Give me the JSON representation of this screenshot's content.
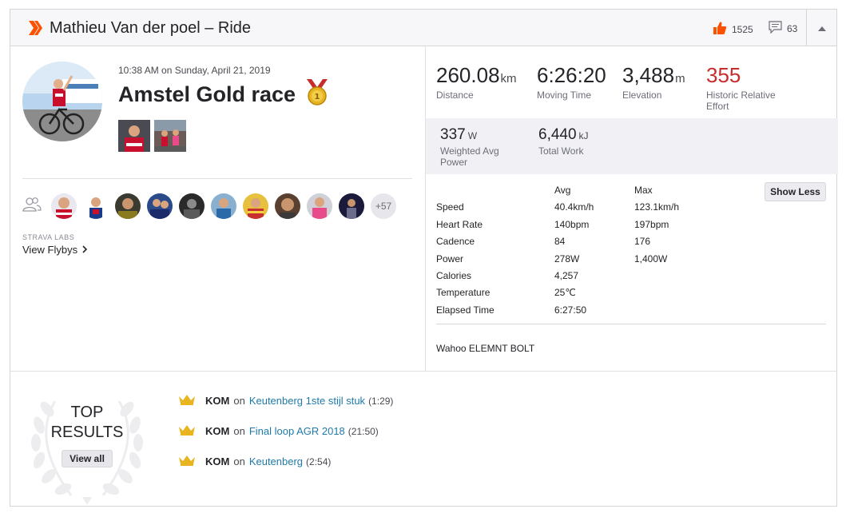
{
  "header": {
    "title": "Mathieu Van der poel – Ride",
    "kudos_count": "1525",
    "comment_count": "63"
  },
  "activity": {
    "datetime": "10:38 AM on Sunday, April 21, 2019",
    "name": "Amstel Gold race"
  },
  "flyby": {
    "labs_label": "STRAVA LABS",
    "link_label": "View Flybys"
  },
  "athletes": {
    "more_count": "+57"
  },
  "stats": {
    "distance": {
      "value": "260.08",
      "unit": "km",
      "label": "Distance"
    },
    "moving_time": {
      "value": "6:26:20",
      "label": "Moving Time"
    },
    "elevation": {
      "value": "3,488",
      "unit": "m",
      "label": "Elevation"
    },
    "relative_effort": {
      "value": "355",
      "label": "Historic Relative Effort"
    },
    "weighted_power": {
      "value": "337",
      "unit": "W",
      "label": "Weighted Avg Power"
    },
    "total_work": {
      "value": "6,440",
      "unit": "kJ",
      "label": "Total Work"
    }
  },
  "more_stats": {
    "avg_header": "Avg",
    "max_header": "Max",
    "show_less_label": "Show Less",
    "rows": [
      {
        "label": "Speed",
        "avg": "40.4km/h",
        "max": "123.1km/h"
      },
      {
        "label": "Heart Rate",
        "avg": "140bpm",
        "max": "197bpm"
      },
      {
        "label": "Cadence",
        "avg": "84",
        "max": "176"
      },
      {
        "label": "Power",
        "avg": "278W",
        "max": "1,400W"
      },
      {
        "label": "Calories",
        "avg": "4,257",
        "max": ""
      },
      {
        "label": "Temperature",
        "avg": "25℃",
        "max": ""
      },
      {
        "label": "Elapsed Time",
        "avg": "6:27:50",
        "max": ""
      }
    ],
    "device": "Wahoo ELEMNT BOLT"
  },
  "top_results": {
    "line1": "TOP",
    "line2": "RESULTS",
    "view_all_label": "View all",
    "achievements": [
      {
        "badge": "KOM",
        "on": "on",
        "segment": "Keutenberg 1ste stijl stuk",
        "time": "(1:29)"
      },
      {
        "badge": "KOM",
        "on": "on",
        "segment": "Final loop AGR 2018",
        "time": "(21:50)"
      },
      {
        "badge": "KOM",
        "on": "on",
        "segment": "Keutenberg",
        "time": "(2:54)"
      }
    ]
  },
  "colors": {
    "brand_orange": "#fc5200",
    "effort_red": "#c62d2d",
    "link_blue": "#1f7aa8",
    "crown_gold": "#e8b520"
  }
}
